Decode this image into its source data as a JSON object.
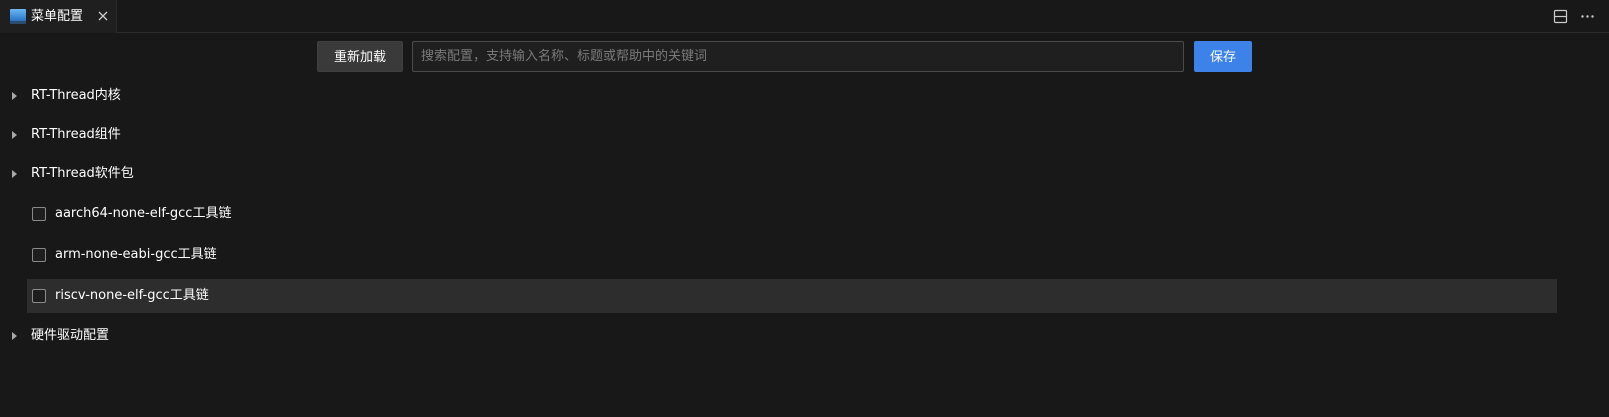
{
  "tab": {
    "title": "菜单配置",
    "icon": "image-icon",
    "close_icon": "close-icon"
  },
  "tabbar_actions": {
    "split_icon": "split-editor-icon",
    "more_icon": "more-actions-icon"
  },
  "toolbar": {
    "reload_label": "重新加载",
    "search_placeholder": "搜索配置，支持输入名称、标题或帮助中的关键词",
    "search_value": "",
    "save_label": "保存"
  },
  "tree": {
    "items": [
      {
        "type": "group",
        "label": "RT-Thread内核",
        "expanded": false
      },
      {
        "type": "group",
        "label": "RT-Thread组件",
        "expanded": false
      },
      {
        "type": "group",
        "label": "RT-Thread软件包",
        "expanded": false
      },
      {
        "type": "checkbox",
        "label": "aarch64-none-elf-gcc工具链",
        "checked": false
      },
      {
        "type": "checkbox",
        "label": "arm-none-eabi-gcc工具链",
        "checked": false
      },
      {
        "type": "checkbox",
        "label": "riscv-none-elf-gcc工具链",
        "checked": false,
        "hovered": true
      },
      {
        "type": "group",
        "label": "硬件驱动配置",
        "expanded": false
      }
    ]
  },
  "colors": {
    "background": "#181818",
    "accent": "#3c82e8",
    "row_highlight": "#2d2d2d"
  }
}
